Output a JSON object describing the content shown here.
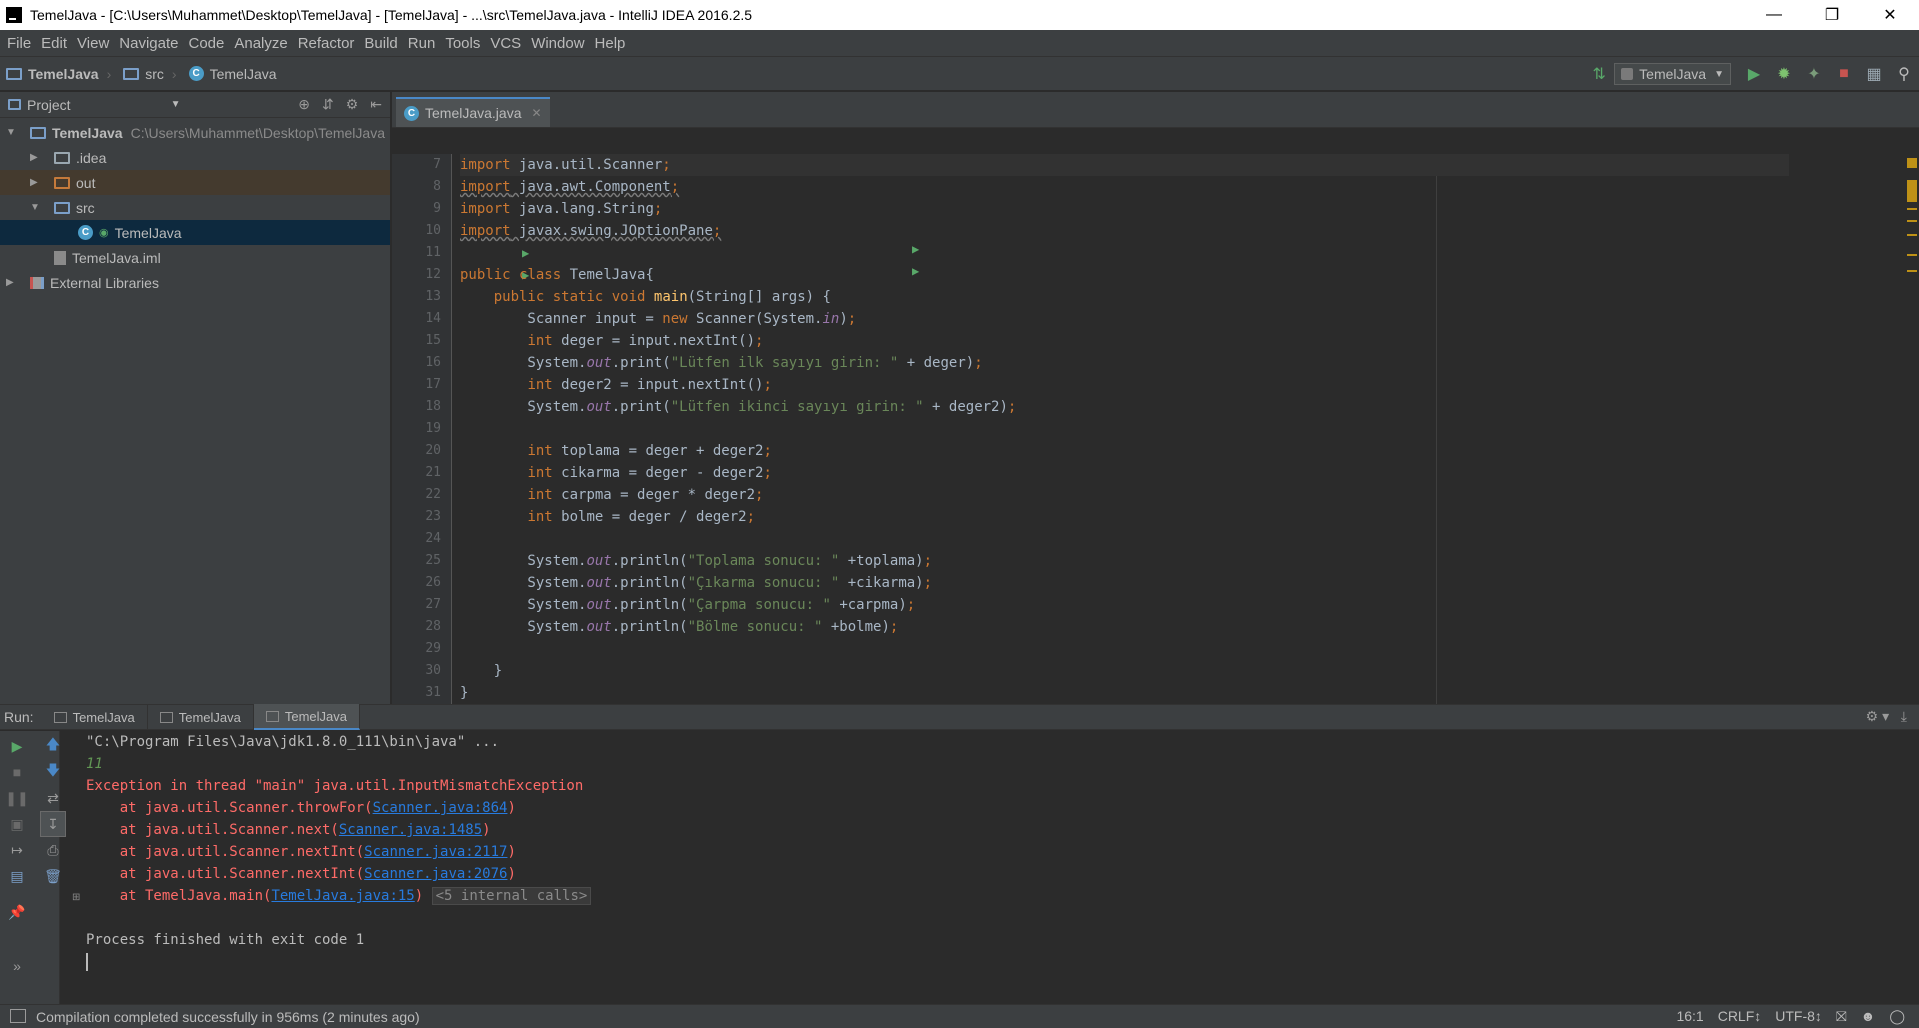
{
  "window": {
    "title": "TemelJava - [C:\\Users\\Muhammet\\Desktop\\TemelJava] - [TemelJava] - ...\\src\\TemelJava.java - IntelliJ IDEA 2016.2.5",
    "controls": [
      "minimize",
      "restore",
      "close"
    ]
  },
  "menu": [
    "File",
    "Edit",
    "View",
    "Navigate",
    "Code",
    "Analyze",
    "Refactor",
    "Build",
    "Run",
    "Tools",
    "VCS",
    "Window",
    "Help"
  ],
  "breadcrumb": [
    "TemelJava",
    "src",
    "TemelJava"
  ],
  "run_config": "TemelJava",
  "project_panel": {
    "title": "Project",
    "tree": [
      {
        "label": "TemelJava",
        "path": "C:\\Users\\Muhammet\\Desktop\\TemelJava"
      },
      {
        "label": ".idea"
      },
      {
        "label": "out"
      },
      {
        "label": "src"
      },
      {
        "label": "TemelJava"
      },
      {
        "label": "TemelJava.iml"
      },
      {
        "label": "External Libraries"
      }
    ]
  },
  "editor": {
    "tab": "TemelJava.java",
    "line_numbers": [
      "7",
      "8",
      "9",
      "10",
      "11",
      "12",
      "13",
      "14",
      "15",
      "16",
      "17",
      "18",
      "19",
      "20",
      "21",
      "22",
      "23",
      "24",
      "25",
      "26",
      "27",
      "28",
      "29",
      "30",
      "31"
    ],
    "code": [
      "import java.util.Scanner;",
      "import java.awt.Component;",
      "import java.lang.String;",
      "import javax.swing.JOptionPane;",
      "",
      "public class TemelJava{",
      "    public static void main(String[] args) {",
      "        Scanner input = new Scanner(System.in);",
      "        int deger = input.nextInt();",
      "        System.out.print(\"Lütfen ilk sayıyı girin: \" + deger);",
      "        int deger2 = input.nextInt();",
      "        System.out.print(\"Lütfen ikinci sayıyı girin: \" + deger2);",
      "",
      "        int toplama = deger + deger2;",
      "        int cikarma = deger - deger2;",
      "        int carpma = deger * deger2;",
      "        int bolme = deger / deger2;",
      "",
      "        System.out.println(\"Toplama sonucu: \" +toplama);",
      "        System.out.println(\"Çıkarma sonucu: \" +cikarma);",
      "        System.out.println(\"Çarpma sonucu: \" +carpma);",
      "        System.out.println(\"Bölme sonucu: \" +bolme);",
      "",
      "    }",
      "}"
    ]
  },
  "run_panel": {
    "label": "Run:",
    "tabs": [
      "TemelJava",
      "TemelJava",
      "TemelJava"
    ],
    "console": {
      "cmd": "\"C:\\Program Files\\Java\\jdk1.8.0_111\\bin\\java\" ...",
      "input": "11",
      "exception": "Exception in thread \"main\" java.util.InputMismatchException",
      "trace": [
        {
          "at": "    at java.util.Scanner.throwFor(",
          "link": "Scanner.java:864",
          "end": ")"
        },
        {
          "at": "    at java.util.Scanner.next(",
          "link": "Scanner.java:1485",
          "end": ")"
        },
        {
          "at": "    at java.util.Scanner.nextInt(",
          "link": "Scanner.java:2117",
          "end": ")"
        },
        {
          "at": "    at java.util.Scanner.nextInt(",
          "link": "Scanner.java:2076",
          "end": ")"
        },
        {
          "at": "    at TemelJava.main(",
          "link": "TemelJava.java:15",
          "end": ")"
        }
      ],
      "internal": "<5 internal calls>",
      "finished": "Process finished with exit code 1"
    }
  },
  "status": {
    "message": "Compilation completed successfully in 956ms (2 minutes ago)",
    "position": "16:1",
    "line_sep": "CRLF↕",
    "encoding": "UTF-8↕"
  }
}
